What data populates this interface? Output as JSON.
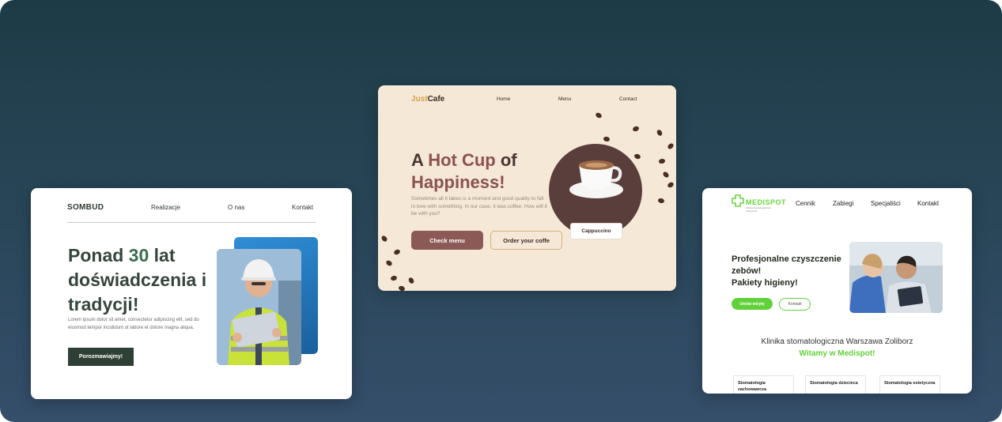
{
  "sombud": {
    "logo": "SOMBUD",
    "nav": [
      "Realizacje",
      "O nas",
      "Kontakt"
    ],
    "headline_pre": "Ponad ",
    "headline_num": "30",
    "headline_post": " lat doświadczenia i tradycji!",
    "lorem": "Lorem ipsum dolor sit amet, consectetur adipiscing elit, sed do eiusmod tempor incididunt ut labore et dolore magna aliqua.",
    "cta": "Porozmawiajmy!"
  },
  "cafe": {
    "logo_just": "Just",
    "logo_cafe": "Cafe",
    "nav": [
      "Home",
      "Menu",
      "Contact"
    ],
    "headline_pre": "A ",
    "headline_acc1": "Hot Cup",
    "headline_mid": " of",
    "headline_acc2": "Happiness!",
    "desc": "Sometimes all it takes is a moment and good quality to fall in love with something. In our case, it was coffee. How will it be with you?",
    "btn_primary": "Check menu",
    "btn_secondary": "Order your coffe",
    "tag": "Cappuccino"
  },
  "medispot": {
    "brand": "MEDISPOT",
    "brand_sub": "Klinika stomatologiczna i estetyczna",
    "nav": [
      "Cennik",
      "Zabiegi",
      "Specjaliści",
      "Kontakt"
    ],
    "headline_1": "Profesjonalne czyszczenie zebów!",
    "headline_2": "Pakiety higieny!",
    "btn_primary": "Umów wizytę",
    "btn_secondary": "Kontakt",
    "clinic": "Klinika stomatologiczna Warszawa Zoliborz",
    "welcome": "Witamy w Medispot!",
    "services": [
      "Stomatologia zachowawcza",
      "Stomatologia dziecieca",
      "Stomatologia estetyczna"
    ]
  },
  "colors": {
    "background_top": "#1d3b46",
    "background_bottom": "#354e6a",
    "sombud_accent": "#2e4035",
    "cafe_accent": "#8b5a56",
    "cafe_logo": "#d8a24a",
    "medispot_green": "#61d13a"
  }
}
